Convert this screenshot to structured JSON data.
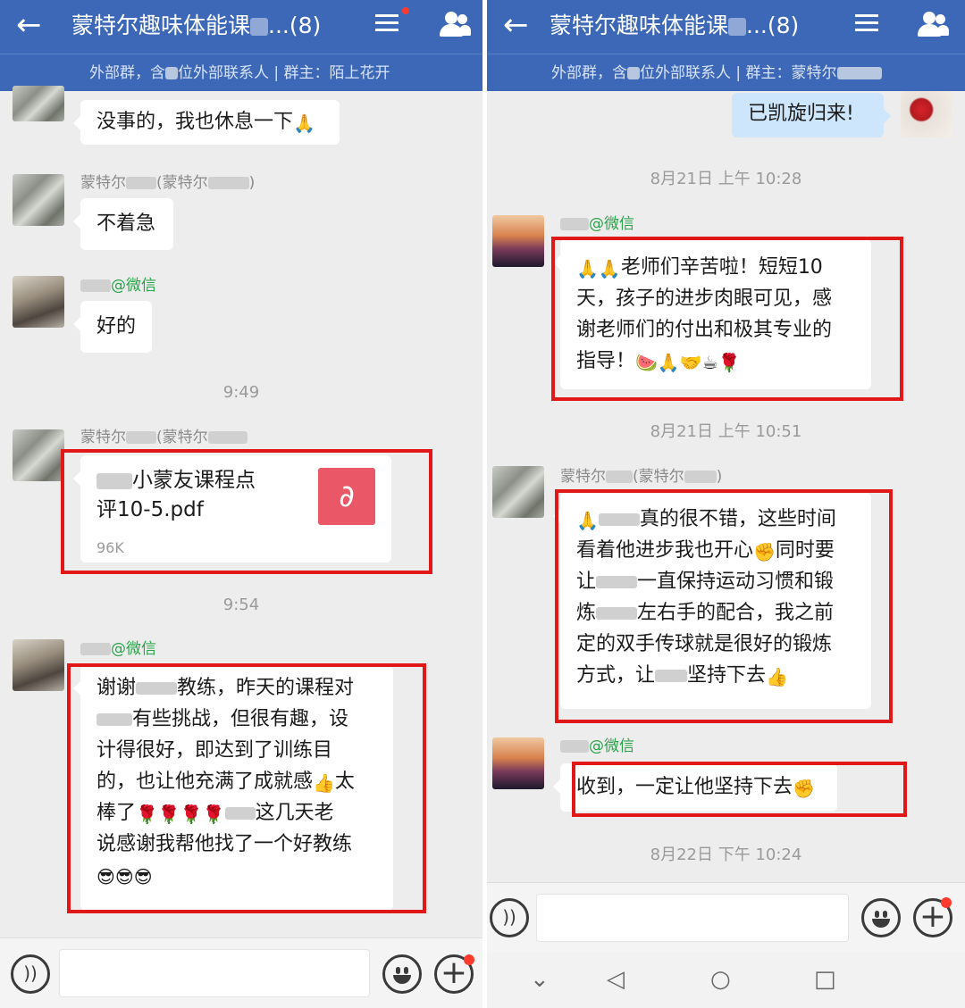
{
  "left": {
    "header": {
      "title": "蒙特尔趣味体能课",
      "title_suffix": "...(8)",
      "subtitle_a": "外部群，含",
      "subtitle_b": "位外部联系人 | 群主：陌上花开"
    },
    "messages": [
      {
        "text": "没事的，我也休息一下"
      },
      {
        "sender_prefix": "蒙特尔",
        "sender_mid": "(蒙特尔",
        "sender_end": ")",
        "text": "不着急"
      },
      {
        "sender_wx": "@微信",
        "text": "好的"
      }
    ],
    "time_1": "9:49",
    "file_msg": {
      "sender_prefix": "蒙特尔",
      "sender_mid": "(蒙特尔",
      "name_line1": "小蒙友课程点",
      "name_line2": "评10-5.pdf",
      "size": "96K"
    },
    "time_2": "9:54",
    "long_msg": {
      "sender_wx": "@微信",
      "line1a": "谢谢",
      "line1b": "教练，昨天的课程对",
      "line2": "有些挑战，但很有趣，设",
      "line3": "计得很好，即达到了训练目",
      "line4a": "的，也让他充满了成就感",
      "line4b": "太",
      "line5a": "棒了",
      "line5b": "这几天老",
      "line6": "说感谢我帮他找了一个好教练"
    }
  },
  "right": {
    "header": {
      "title": "蒙特尔趣味体能课",
      "title_suffix": "...(8)",
      "subtitle_a": "外部群，含",
      "subtitle_b": "位外部联系人 | 群主：蒙特尔"
    },
    "my_msg": "已凯旋归来!",
    "time_1": "8月21日  上午 10:28",
    "msg_1": {
      "sender_wx": "@微信",
      "line1": "老师们辛苦啦！短短10",
      "line2": "天，孩子的进步肉眼可见，感",
      "line3": "谢老师们的付出和极其专业的",
      "line4": "指导！"
    },
    "time_2": "8月21日  上午 10:51",
    "msg_2": {
      "sender_prefix": "蒙特尔",
      "sender_mid": "(蒙特尔",
      "sender_end": ")",
      "line1": "真的很不错，这些时间",
      "line2a": "看着他进步我也开心",
      "line2b": "同时要",
      "line3a": "让",
      "line3b": "一直保持运动习惯和锻",
      "line4a": "炼",
      "line4b": "左右手的配合，我之前",
      "line5": "定的双手传球就是很好的锻炼",
      "line6a": "方式，让",
      "line6b": "坚持下去"
    },
    "msg_3": {
      "sender_wx": "@微信",
      "text": "收到，一定让他坚持下去"
    },
    "time_3": "8月22日  下午 10:24"
  },
  "icons": {
    "back": "←",
    "voice": "))",
    "plus": "+",
    "pdf": "∂",
    "nav_back": "◁",
    "nav_home": "○",
    "nav_recent": "□",
    "nav_down": "⌄"
  },
  "colors": {
    "header": "#3d68b8",
    "highlight_box": "#e01818",
    "wechat_tag": "#2aa34a",
    "my_bubble": "#cde6fb",
    "pdf": "#ea5867"
  }
}
